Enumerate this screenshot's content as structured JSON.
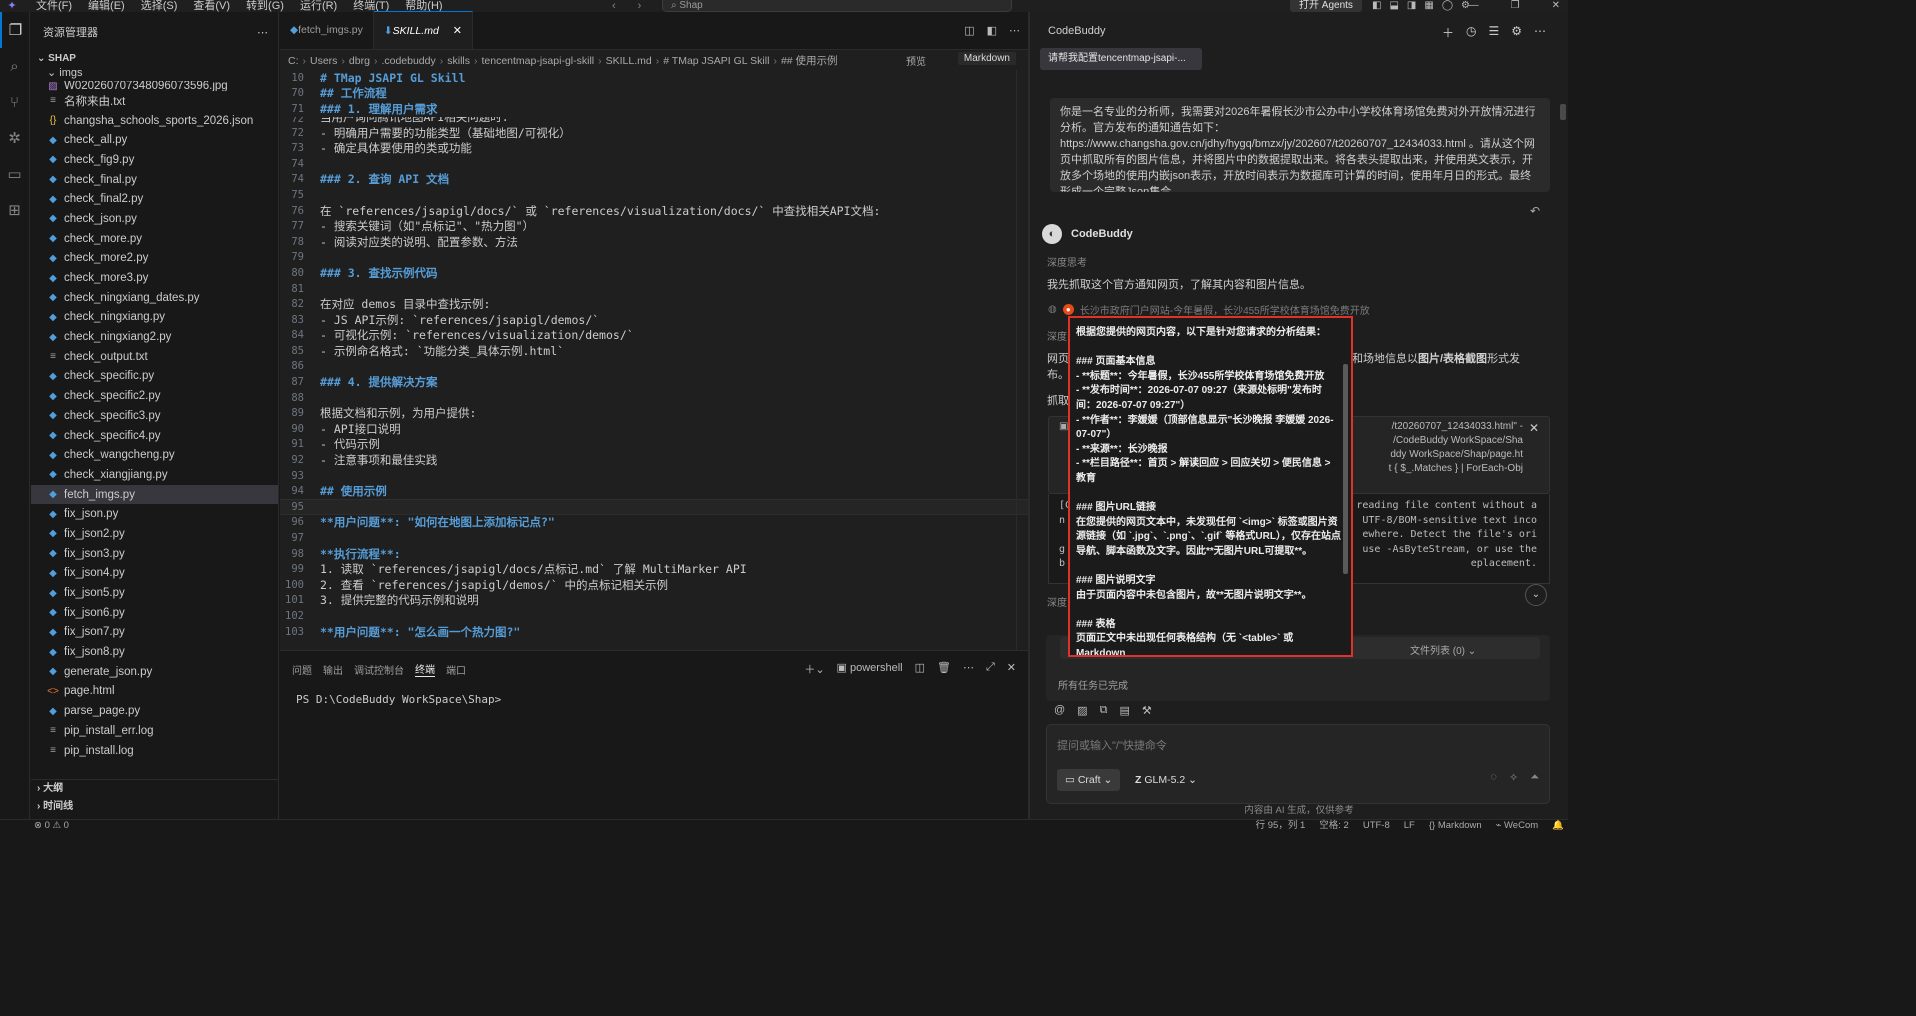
{
  "titlebar": {
    "menus": [
      "文件(F)",
      "编辑(E)",
      "选择(S)",
      "查看(V)",
      "转到(G)",
      "运行(R)",
      "终端(T)",
      "帮助(H)"
    ],
    "search": "Shap",
    "agents_button": "打开 Agents"
  },
  "explorer": {
    "title": "资源管理器",
    "project": "SHAP",
    "folder": "imgs",
    "files": [
      {
        "name": "W020260707348096073596.jpg",
        "type": "jpg"
      },
      {
        "name": "名称来由.txt",
        "type": "txt"
      },
      {
        "name": "changsha_schools_sports_2026.json",
        "type": "json"
      },
      {
        "name": "check_all.py",
        "type": "py"
      },
      {
        "name": "check_fig9.py",
        "type": "py"
      },
      {
        "name": "check_final.py",
        "type": "py"
      },
      {
        "name": "check_final2.py",
        "type": "py"
      },
      {
        "name": "check_json.py",
        "type": "py"
      },
      {
        "name": "check_more.py",
        "type": "py"
      },
      {
        "name": "check_more2.py",
        "type": "py"
      },
      {
        "name": "check_more3.py",
        "type": "py"
      },
      {
        "name": "check_ningxiang_dates.py",
        "type": "py"
      },
      {
        "name": "check_ningxiang.py",
        "type": "py"
      },
      {
        "name": "check_ningxiang2.py",
        "type": "py"
      },
      {
        "name": "check_output.txt",
        "type": "txt"
      },
      {
        "name": "check_specific.py",
        "type": "py"
      },
      {
        "name": "check_specific2.py",
        "type": "py"
      },
      {
        "name": "check_specific3.py",
        "type": "py"
      },
      {
        "name": "check_specific4.py",
        "type": "py"
      },
      {
        "name": "check_wangcheng.py",
        "type": "py"
      },
      {
        "name": "check_xiangjiang.py",
        "type": "py"
      },
      {
        "name": "fetch_imgs.py",
        "type": "py",
        "selected": true
      },
      {
        "name": "fix_json.py",
        "type": "py"
      },
      {
        "name": "fix_json2.py",
        "type": "py"
      },
      {
        "name": "fix_json3.py",
        "type": "py"
      },
      {
        "name": "fix_json4.py",
        "type": "py"
      },
      {
        "name": "fix_json5.py",
        "type": "py"
      },
      {
        "name": "fix_json6.py",
        "type": "py"
      },
      {
        "name": "fix_json7.py",
        "type": "py"
      },
      {
        "name": "fix_json8.py",
        "type": "py"
      },
      {
        "name": "generate_json.py",
        "type": "py"
      },
      {
        "name": "page.html",
        "type": "html"
      },
      {
        "name": "parse_page.py",
        "type": "py"
      },
      {
        "name": "pip_install_err.log",
        "type": "txt"
      },
      {
        "name": "pip_install.log",
        "type": "txt"
      }
    ],
    "outline": "大纲",
    "timeline": "时间线"
  },
  "editor": {
    "tabs": [
      {
        "label": "fetch_imgs.py",
        "active": false
      },
      {
        "label": "SKILL.md",
        "active": true
      }
    ],
    "breadcrumb": [
      "C:",
      "Users",
      "dbrg",
      ".codebuddy",
      "skills",
      "tencentmap-jsapi-gl-skill",
      "SKILL.md",
      "# TMap JSAPI GL Skill",
      "## 使用示例"
    ],
    "preview": "预览",
    "language": "Markdown",
    "lines": [
      {
        "n": "10",
        "t": "# TMap JSAPI GL Skill",
        "k": "h"
      },
      {
        "n": "70",
        "t": "## 工作流程",
        "k": "h"
      },
      {
        "n": "71",
        "t": "### 1. 理解用户需求",
        "k": "h"
      },
      {
        "n": "72",
        "t": "当用户询问腾讯地图API相关问题时:",
        "k": ""
      },
      {
        "n": "72",
        "t": "- 明确用户需要的功能类型（基础地图/可视化）",
        "k": ""
      },
      {
        "n": "73",
        "t": "- 确定具体要使用的类或功能",
        "k": ""
      },
      {
        "n": "74",
        "t": "",
        "k": ""
      },
      {
        "n": "74",
        "t": "### 2. 查询 API 文档",
        "k": "h"
      },
      {
        "n": "75",
        "t": "",
        "k": ""
      },
      {
        "n": "76",
        "t": "在 `references/jsapigl/docs/` 或 `references/visualization/docs/` 中查找相关API文档:",
        "k": ""
      },
      {
        "n": "77",
        "t": "- 搜索关键词（如\"点标记\"、\"热力图\"）",
        "k": ""
      },
      {
        "n": "78",
        "t": "- 阅读对应类的说明、配置参数、方法",
        "k": ""
      },
      {
        "n": "79",
        "t": "",
        "k": ""
      },
      {
        "n": "80",
        "t": "### 3. 查找示例代码",
        "k": "h"
      },
      {
        "n": "81",
        "t": "",
        "k": ""
      },
      {
        "n": "82",
        "t": "在对应 demos 目录中查找示例:",
        "k": ""
      },
      {
        "n": "83",
        "t": "- JS API示例: `references/jsapigl/demos/`",
        "k": ""
      },
      {
        "n": "84",
        "t": "- 可视化示例: `references/visualization/demos/`",
        "k": ""
      },
      {
        "n": "85",
        "t": "- 示例命名格式: `功能分类_具体示例.html`",
        "k": ""
      },
      {
        "n": "86",
        "t": "",
        "k": ""
      },
      {
        "n": "87",
        "t": "### 4. 提供解决方案",
        "k": "h"
      },
      {
        "n": "88",
        "t": "",
        "k": ""
      },
      {
        "n": "89",
        "t": "根据文档和示例，为用户提供:",
        "k": ""
      },
      {
        "n": "90",
        "t": "- API接口说明",
        "k": ""
      },
      {
        "n": "91",
        "t": "- 代码示例",
        "k": ""
      },
      {
        "n": "92",
        "t": "- 注意事项和最佳实践",
        "k": ""
      },
      {
        "n": "93",
        "t": "",
        "k": ""
      },
      {
        "n": "94",
        "t": "## 使用示例",
        "k": "h"
      },
      {
        "n": "95",
        "t": "",
        "k": "cur"
      },
      {
        "n": "96",
        "t": "**用户问题**: \"如何在地图上添加标记点?\"",
        "k": "b"
      },
      {
        "n": "97",
        "t": "",
        "k": ""
      },
      {
        "n": "98",
        "t": "**执行流程**:",
        "k": "b"
      },
      {
        "n": "99",
        "t": "1. 读取 `references/jsapigl/docs/点标记.md` 了解 MultiMarker API",
        "k": ""
      },
      {
        "n": "100",
        "t": "2. 查看 `references/jsapigl/demos/` 中的点标记相关示例",
        "k": ""
      },
      {
        "n": "101",
        "t": "3. 提供完整的代码示例和说明",
        "k": ""
      },
      {
        "n": "102",
        "t": "",
        "k": ""
      },
      {
        "n": "103",
        "t": "**用户问题**: \"怎么画一个热力图?\"",
        "k": "b"
      }
    ]
  },
  "panel": {
    "tabs": [
      "问题",
      "输出",
      "调试控制台",
      "终端",
      "端口"
    ],
    "active_tab": "终端",
    "shell": "powershell",
    "prompt": "PS D:\\CodeBuddy WorkSpace\\Shap>"
  },
  "chat": {
    "title": "CodeBuddy",
    "session_tab": "请帮我配置tencentmap-jsapi-...",
    "user_message": "你是一名专业的分析师，我需要对2026年暑假长沙市公办中小学校体育场馆免费对外开放情况进行分析。官方发布的通知通告如下：https://www.changsha.gov.cn/jdhy/hygq/bmzx/jy/202607/t20260707_12434033.html 。请从这个网页中抓取所有的图片信息，并将图片中的数据提取出来。将各表头提取出来，并使用英文表示，开放多个场地的使用内嵌json表示，开放时间表示为数据库可计算的时间，使用年月日的形式。最终形成一个完整Json集合。",
    "bot_name": "CodeBuddy",
    "thinking_label": "深度思考",
    "bot_line1": "我先抓取这个官方通知网页，了解其内容和图片信息。",
    "link_text": "长沙市政府门户网站-今年暑假，长沙455所学校体育场馆免费开放",
    "partial1": "深度",
    "partial2": "网页",
    "partial2_tail": "和场地信息以",
    "partial2_bold": "图片/表格截图",
    "partial2_end": "形式发",
    "partial3": "布。",
    "partial4": "抓取",
    "tool_lines": [
      "/t20260707_12434033.html\" -",
      "/CodeBuddy WorkSpace/Sha",
      "ddy WorkSpace/Shap/page.ht",
      "t { $_.Matches } | ForEach-Obj"
    ],
    "code_start": "[C",
    "code_lines": [
      "reading file content without a",
      "UTF-8/BOM-sensitive text inco",
      "ewhere. Detect the file's ori",
      "use -AsByteStream, or use the",
      "eplacement."
    ],
    "code_prefixes": [
      "n",
      "",
      "g",
      "b"
    ],
    "partial5": "深度",
    "files_list": "文件列表 (0)",
    "all_done": "所有任务已完成",
    "input_placeholder": "提问或输入\"/\"快捷命令",
    "mode": "Craft",
    "model": "GLM-5.2",
    "disclaimer": "内容由 AI 生成，仅供参考"
  },
  "popup": {
    "lines": [
      "根据您提供的网页内容，以下是针对您请求的分析结果：",
      "",
      "### 页面基本信息",
      "- **标题**：今年暑假，长沙455所学校体育场馆免费开放",
      "- **发布时间**：2026-07-07 09:27（来源处标明\"发布时间：2026-07-07 09:27\"）",
      "- **作者**：李媛媛（顶部信息显示\"长沙晚报 李媛媛 2026-07-07\"）",
      "- **来源**：长沙晚报",
      "- **栏目路径**：首页 > 解读回应 > 回应关切 > 便民信息 > 教育",
      "",
      "### 图片URL链接",
      "在您提供的网页文本中，未发现任何 `<img>` 标签或图片资源链接（如 `.jpg`、`.png`、`.gif` 等格式URL），仅存在站点导航、脚本函数及文字。因此**无图片URL可提取**。",
      "",
      "### 图片说明文字",
      "由于页面内容中未包含图片，故**无图片说明文字**。",
      "",
      "### 表格",
      "页面正文中未出现任何表格结构（无 `<table>` 或 Markdown"
    ]
  },
  "statusbar": {
    "problems": "⊗ 0 ⚠ 0",
    "position": "行 95，列 1",
    "spaces": "空格: 2",
    "encoding": "UTF-8",
    "eol": "LF",
    "language": "{} Markdown",
    "account": "WeCom"
  },
  "colors": {
    "accent": "#0078d4",
    "highlight_border": "#e0312b"
  }
}
